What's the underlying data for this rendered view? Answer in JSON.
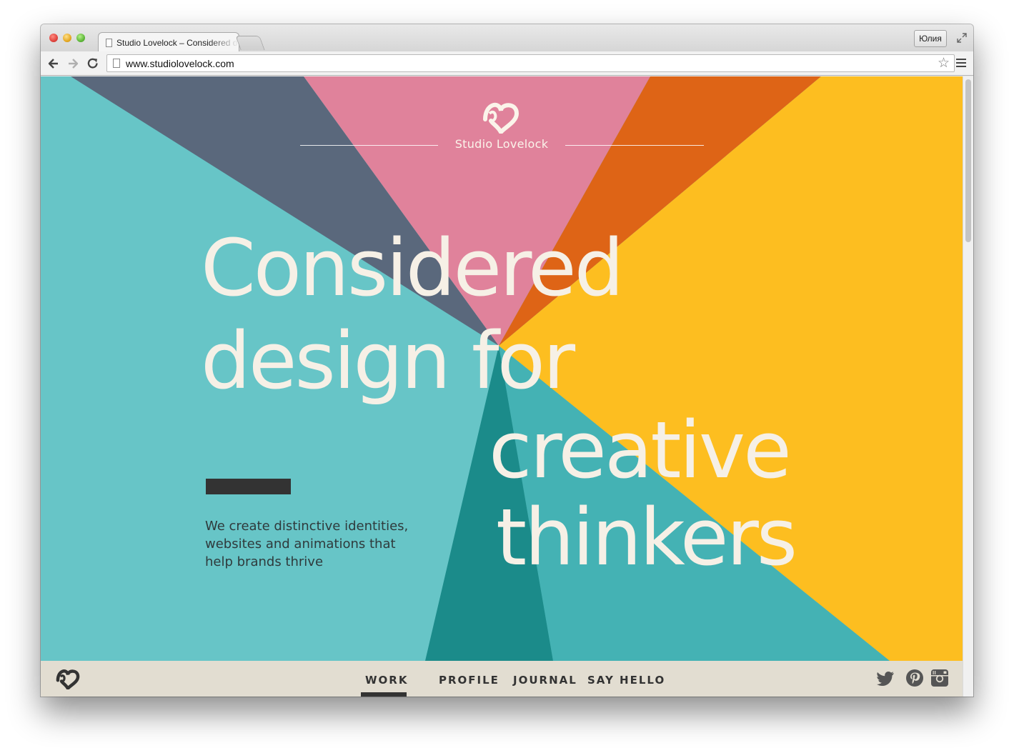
{
  "browser": {
    "tab_title": "Studio Lovelock – Considered design for creative thinkers",
    "profile_name": "Юлия",
    "url": "www.studiolovelock.com"
  },
  "site": {
    "brand_name": "Studio Lovelock",
    "headline_lines": [
      "Considered",
      "design for",
      "creative",
      "thinkers"
    ],
    "tagline_lines": [
      "We create distinctive identities,",
      "websites and animations that",
      "help brands thrive"
    ],
    "nav": [
      {
        "label": "WORK",
        "active": true
      },
      {
        "label": "PROFILE",
        "active": false
      },
      {
        "label": "JOURNAL",
        "active": false
      },
      {
        "label": "SAY HELLO",
        "active": false
      }
    ],
    "social_icons": [
      "twitter-icon",
      "pinterest-icon",
      "instagram-icon"
    ],
    "colors": {
      "teal_light": "#67c5c7",
      "slate": "#5a687c",
      "pink": "#e0829b",
      "orange": "#de6416",
      "yellow": "#fdbe20",
      "teal_mid": "#44b2b4",
      "teal_dark": "#1b8b8a",
      "cream_text": "#f6f0e6",
      "footer_bg": "#e2ddd1"
    }
  }
}
